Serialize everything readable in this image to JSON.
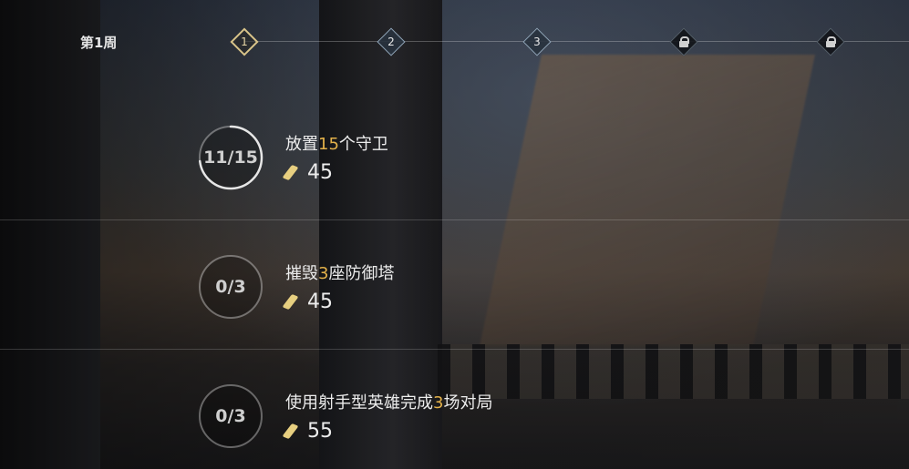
{
  "week": {
    "label": "第1周"
  },
  "milestones": [
    {
      "label": "1",
      "state": "active"
    },
    {
      "label": "2",
      "state": "unlocked"
    },
    {
      "label": "3",
      "state": "unlocked"
    },
    {
      "label": "",
      "state": "locked"
    },
    {
      "label": "",
      "state": "locked"
    }
  ],
  "tasks": [
    {
      "progress_text": "11/15",
      "progress_fraction": 0.73,
      "desc_pre": "放置",
      "desc_num": "15",
      "desc_post": "个守卫",
      "reward": "45"
    },
    {
      "progress_text": "0/3",
      "progress_fraction": 0,
      "desc_pre": "摧毁",
      "desc_num": "3",
      "desc_post": "座防御塔",
      "reward": "45"
    },
    {
      "progress_text": "0/3",
      "progress_fraction": 0,
      "desc_pre": "使用射手型英雄完成",
      "desc_num": "3",
      "desc_post": "场对局",
      "reward": "55"
    }
  ],
  "colors": {
    "highlight": "#e3b14a",
    "coin": "#e7cf80",
    "active_node": "#d9c48a"
  }
}
